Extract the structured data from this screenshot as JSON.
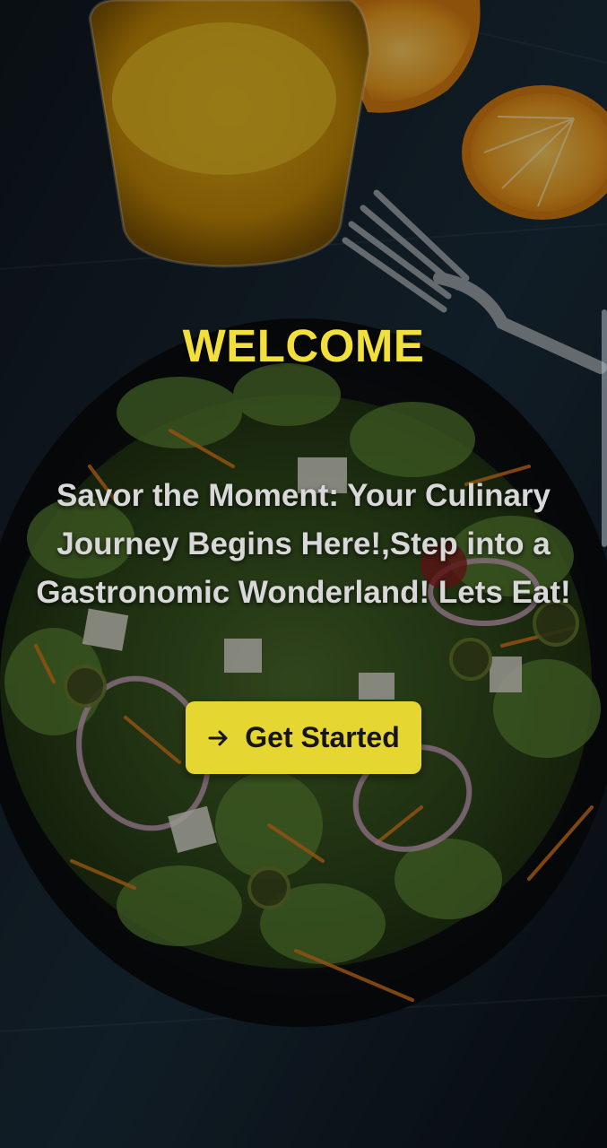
{
  "welcome_title": "WELCOME",
  "tagline": "Savor the Moment: Your Culinary Journey Begins Here!,Step into a Gastronomic Wonderland! Lets Eat!",
  "cta": {
    "label": "Get Started",
    "icon": "arrow-right-icon"
  },
  "background": {
    "subject": "salad-bowl-with-orange-juice",
    "colors": {
      "accent_yellow": "#e6d632",
      "title_yellow": "#f1df3b",
      "text_light": "#d8d8d8",
      "background_dark": "#0c1116"
    }
  }
}
